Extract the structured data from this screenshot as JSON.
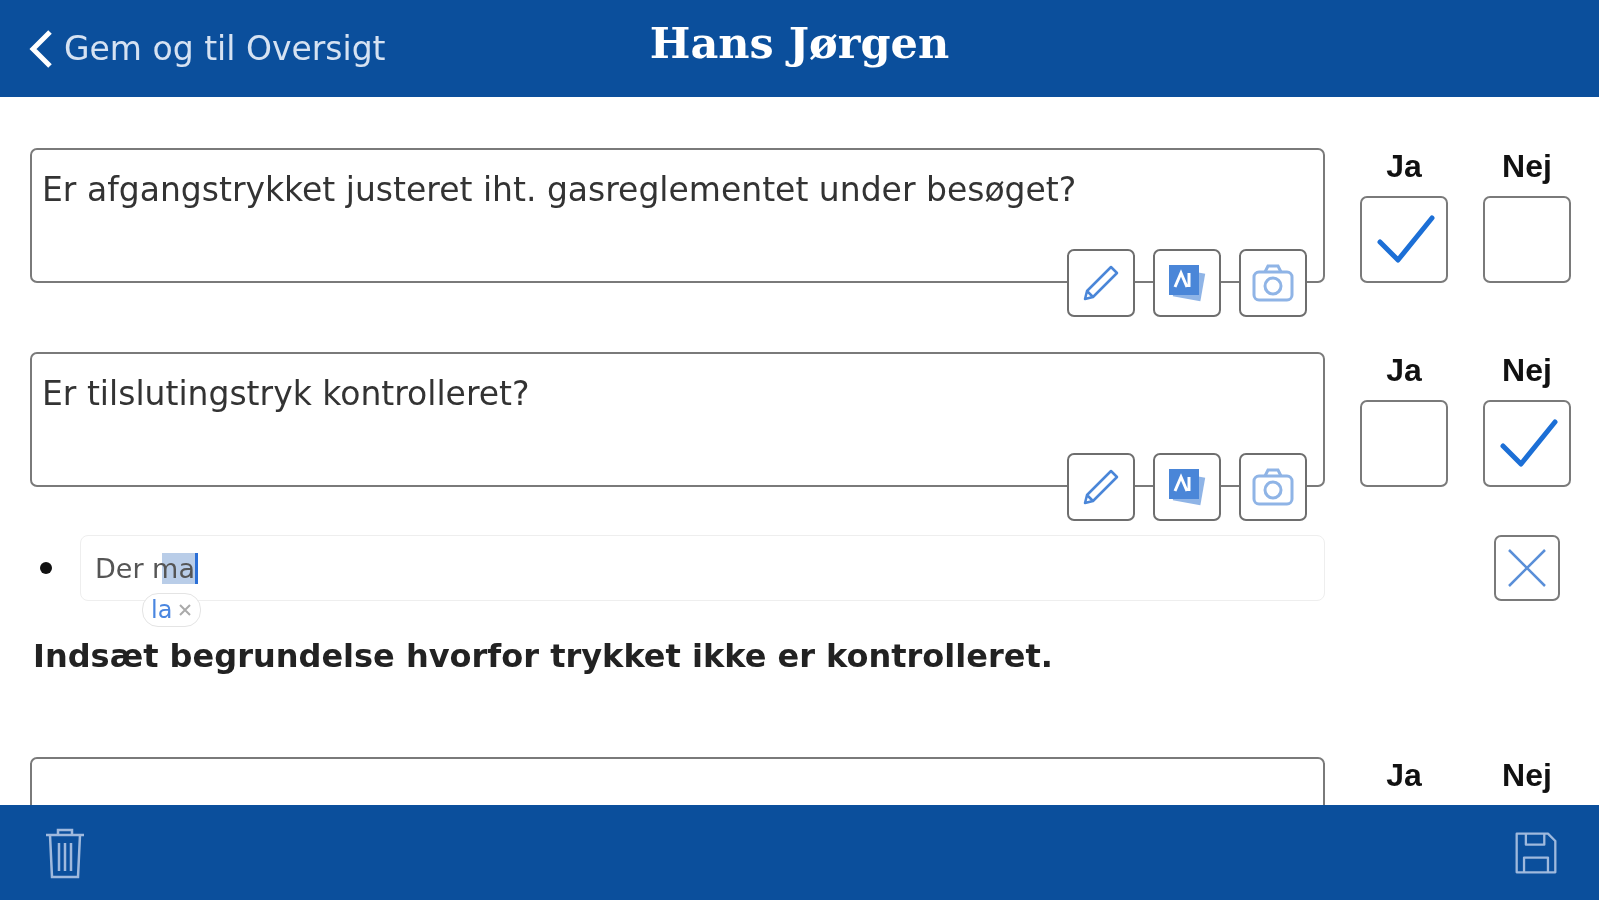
{
  "header": {
    "back_label": "Gem og til Oversigt",
    "title": "Hans Jørgen"
  },
  "questions": [
    {
      "text": "Er afgangstrykket justeret iht. gasreglementet under besøget?",
      "yes_label": "Ja",
      "no_label": "Nej",
      "yes_checked": true,
      "no_checked": false
    },
    {
      "text": "Er tilslutingstryk kontrolleret?",
      "yes_label": "Ja",
      "no_label": "Nej",
      "yes_checked": false,
      "no_checked": true,
      "comment": {
        "value": "Der ma",
        "last_word_selected": true,
        "suggestion": "la"
      },
      "note": "Indsæt begrundelse hvorfor trykket ikke er kontrolleret."
    },
    {
      "yes_label": "Ja",
      "no_label": "Nej"
    }
  ]
}
